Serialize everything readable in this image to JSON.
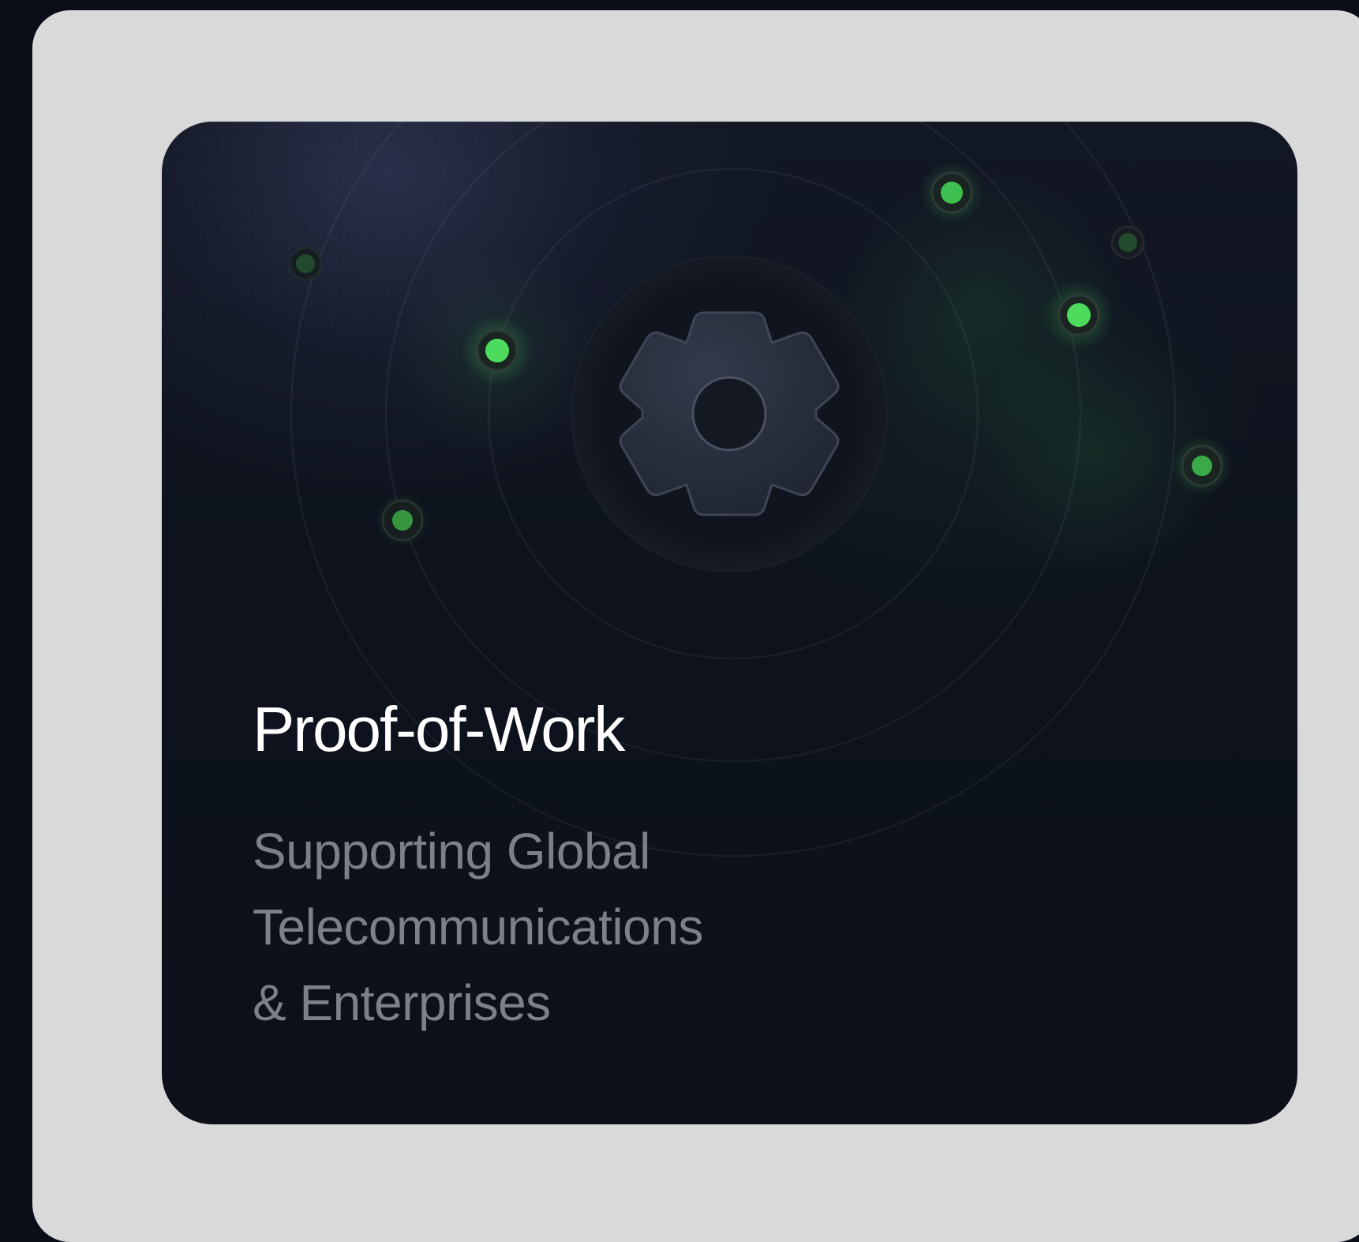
{
  "card": {
    "title": "Proof-of-Work",
    "subtitle_lines": [
      "Supporting Global",
      "Telecommunications",
      "& Enterprises"
    ]
  },
  "illustration": {
    "icon": "gear-icon",
    "node_icon": "green-node-dot",
    "colors": {
      "node_bright": "#4cdb5c",
      "node_dim": "#2f8a3d",
      "gear": "#2a2f3c",
      "card_background": "#0d121c",
      "frame": "#d9d9d9"
    }
  }
}
